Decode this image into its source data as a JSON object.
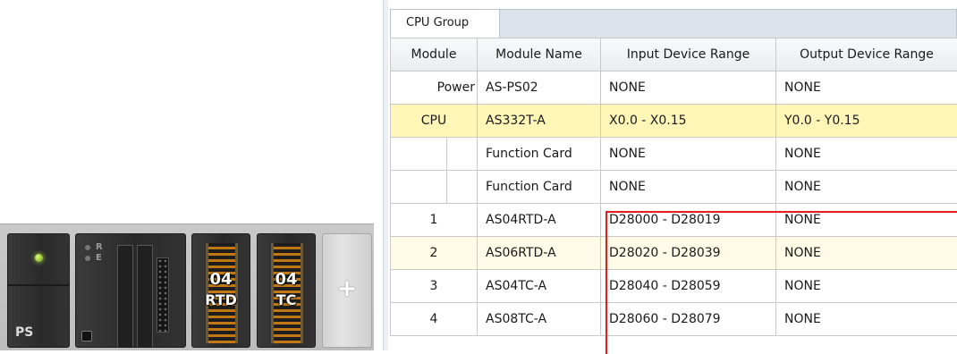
{
  "rack": {
    "ps_label": "PS",
    "cpu_leds": [
      "R",
      "E"
    ],
    "io_modules": [
      {
        "number": "04",
        "type": "RTD"
      },
      {
        "number": "04",
        "type": "TC"
      }
    ],
    "add_symbol": "+"
  },
  "tab": {
    "label": "CPU Group"
  },
  "table": {
    "headers": [
      "Module",
      "Module Name",
      "Input Device Range",
      "Output Device Range"
    ],
    "rows": [
      {
        "module": "Power",
        "name": "AS-PS02",
        "input": "NONE",
        "output": "NONE"
      },
      {
        "module": "CPU",
        "name": "AS332T-A",
        "input": "X0.0 - X0.15",
        "output": "Y0.0 - Y0.15"
      },
      {
        "module": "",
        "name": "Function Card",
        "input": "NONE",
        "output": "NONE"
      },
      {
        "module": "",
        "name": "Function Card",
        "input": "NONE",
        "output": "NONE"
      },
      {
        "module": "1",
        "name": "AS04RTD-A",
        "input": "D28000 - D28019",
        "output": "NONE"
      },
      {
        "module": "2",
        "name": "AS06RTD-A",
        "input": "D28020 - D28039",
        "output": "NONE"
      },
      {
        "module": "3",
        "name": "AS04TC-A",
        "input": "D28040 - D28059",
        "output": "NONE"
      },
      {
        "module": "4",
        "name": "AS08TC-A",
        "input": "D28060 - D28079",
        "output": "NONE"
      }
    ]
  },
  "colors": {
    "highlight_row": "#fff6b8",
    "selection_border": "#e02020"
  }
}
